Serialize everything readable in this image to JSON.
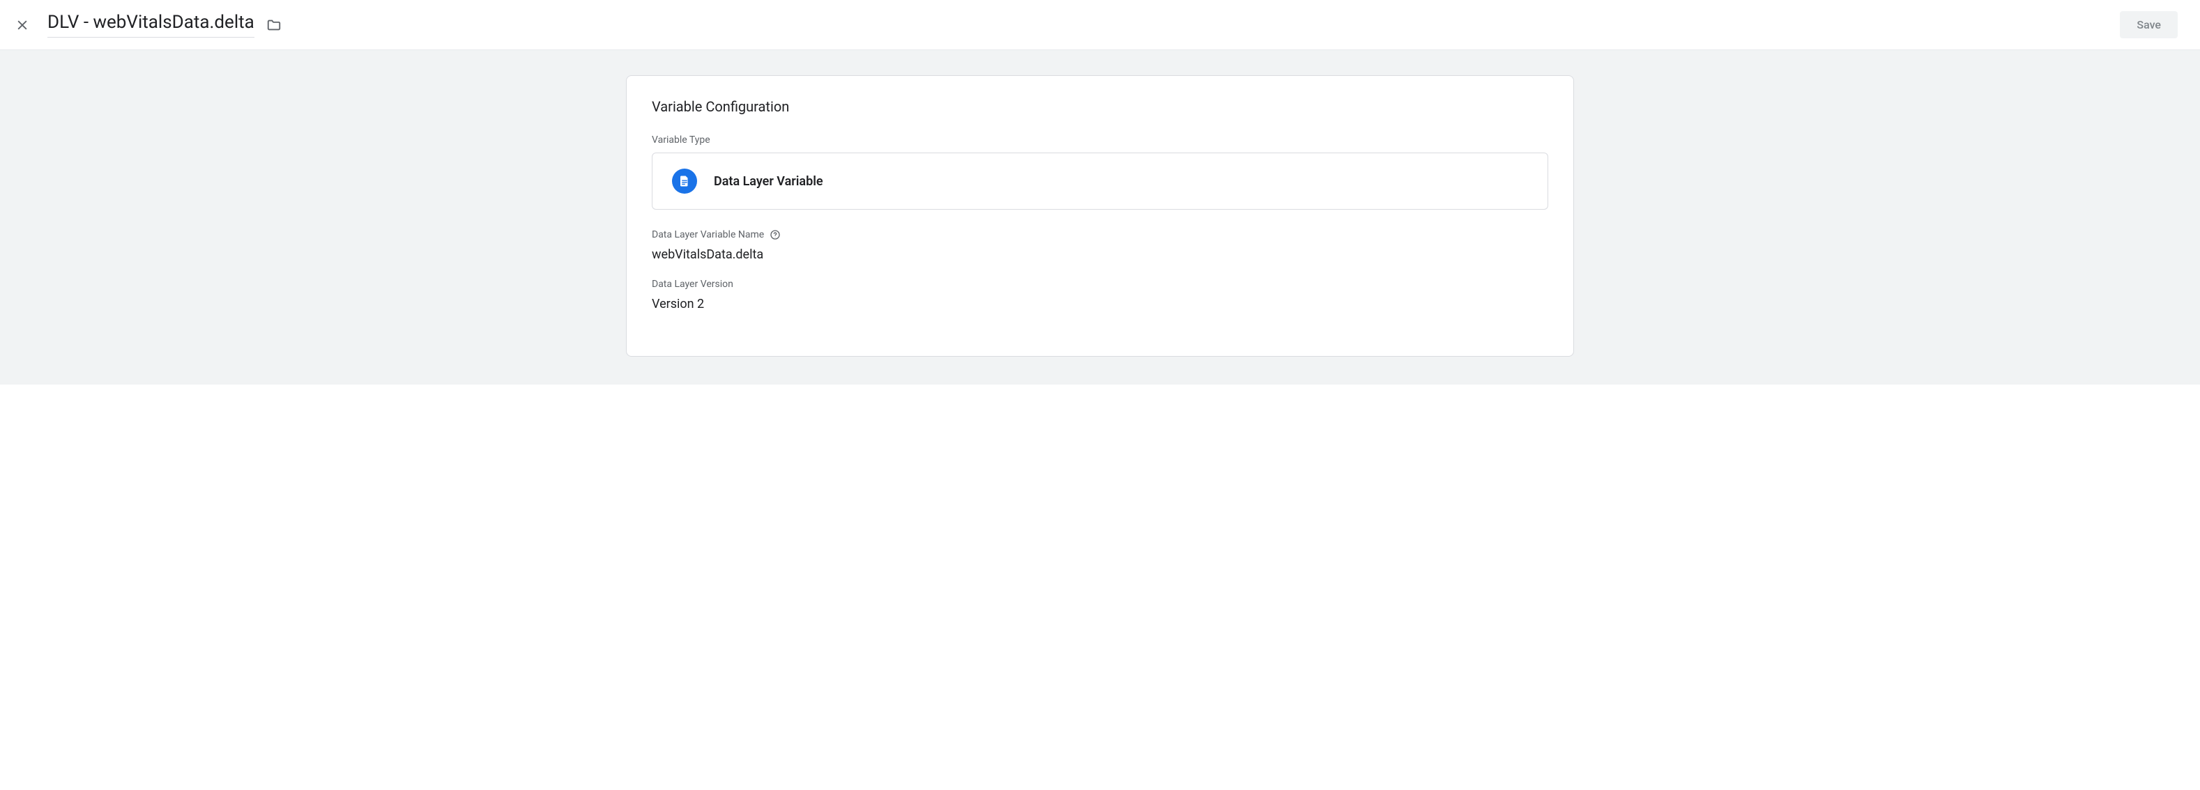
{
  "header": {
    "title": "DLV - webVitalsData.delta",
    "save_label": "Save"
  },
  "card": {
    "title": "Variable Configuration",
    "variable_type_label": "Variable Type",
    "variable_type_value": "Data Layer Variable",
    "variable_name_label": "Data Layer Variable Name",
    "variable_name_value": "webVitalsData.delta",
    "version_label": "Data Layer Version",
    "version_value": "Version 2"
  }
}
